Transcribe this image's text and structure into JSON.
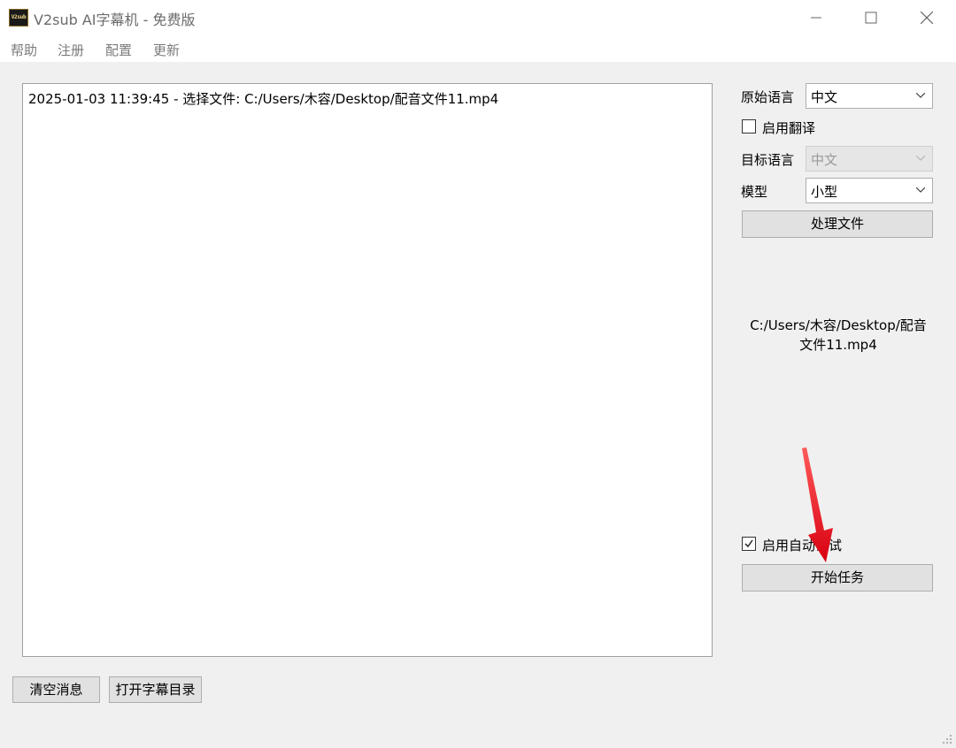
{
  "window": {
    "logo_text": "V2sub",
    "title": "V2sub AI字幕机 - 免费版"
  },
  "menu": {
    "items": [
      "帮助",
      "注册",
      "配置",
      "更新"
    ]
  },
  "log": {
    "lines": [
      "2025-01-03 11:39:45 - 选择文件: C:/Users/木容/Desktop/配音文件11.mp4"
    ]
  },
  "panel": {
    "source_language_label": "原始语言",
    "source_language_value": "中文",
    "enable_translation_label": "启用翻译",
    "enable_translation_checked": false,
    "target_language_label": "目标语言",
    "target_language_value": "中文",
    "model_label": "模型",
    "model_value": "小型",
    "process_file_button": "处理文件",
    "file_path_line1": "C:/Users/木容/Desktop/配音",
    "file_path_line2": "文件11.mp4",
    "auto_debug_label": "启用自动调试",
    "auto_debug_checked": true,
    "start_task_button": "开始任务"
  },
  "bottom": {
    "clear_messages_button": "清空消息",
    "open_subtitle_dir_button": "打开字幕目录"
  },
  "colors": {
    "annotation_arrow": "#e8101a",
    "button_bg": "#e1e1e1",
    "window_bg": "#f0f0f0"
  }
}
